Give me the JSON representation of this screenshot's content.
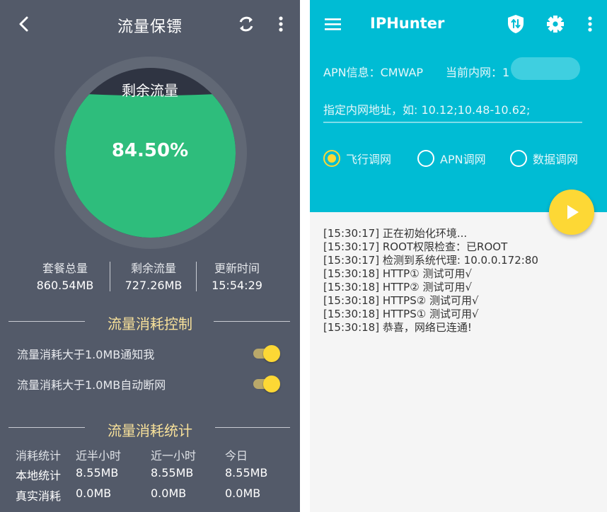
{
  "left": {
    "title": "流量保镖",
    "gauge": {
      "label": "剩余流量",
      "value": "84.50%",
      "fraction": 0.845
    },
    "stats": [
      {
        "label": "套餐总量",
        "value": "860.54MB"
      },
      {
        "label": "剩余流量",
        "value": "727.26MB"
      },
      {
        "label": "更新时间",
        "value": "15:54:29"
      }
    ],
    "control": {
      "heading": "流量消耗控制",
      "items": [
        {
          "label": "流量消耗大于1.0MB通知我",
          "on": true
        },
        {
          "label": "流量消耗大于1.0MB自动断网",
          "on": true
        }
      ]
    },
    "stats_table": {
      "heading": "流量消耗统计",
      "headers": [
        "消耗统计",
        "近半小时",
        "近一小时",
        "今日"
      ],
      "rows": [
        [
          "本地统计",
          "8.55MB",
          "8.55MB",
          "8.55MB"
        ],
        [
          "真实消耗",
          "0.0MB",
          "0.0MB",
          "0.0MB"
        ]
      ]
    }
  },
  "right": {
    "app_title": "IPHunter",
    "apn_info": "APN信息：CMWAP",
    "lan_info": "当前内网：1",
    "input_placeholder": "指定内网地址，如: 10.12;10.48-10.62;",
    "radios": [
      {
        "label": "飞行调网",
        "selected": true
      },
      {
        "label": "APN调网",
        "selected": false
      },
      {
        "label": "数据调网",
        "selected": false
      }
    ],
    "log": [
      "[15:30:17] 正在初始化环境...",
      "[15:30:17] ROOT权限检查：已ROOT",
      "[15:30:17] 检测到系统代理:   10.0.0.172:80",
      "[15:30:18] HTTP①   测试可用√",
      "[15:30:18] HTTP②   测试可用√",
      "[15:30:18] HTTPS② 测试可用√",
      "[15:30:18] HTTPS① 测试可用√",
      "[15:30:18] 恭喜，网络已连通!"
    ]
  },
  "colors": {
    "left_bg": "#535a69",
    "gauge_green": "#2ebd7c",
    "accent_yellow": "#fdd835",
    "heading_yellow": "#f8e19a",
    "cyan": "#00bcd4"
  },
  "icons": [
    "back-icon",
    "sync-icon",
    "more-vert-icon",
    "menu-icon",
    "shield-icon",
    "gear-icon",
    "play-icon"
  ]
}
